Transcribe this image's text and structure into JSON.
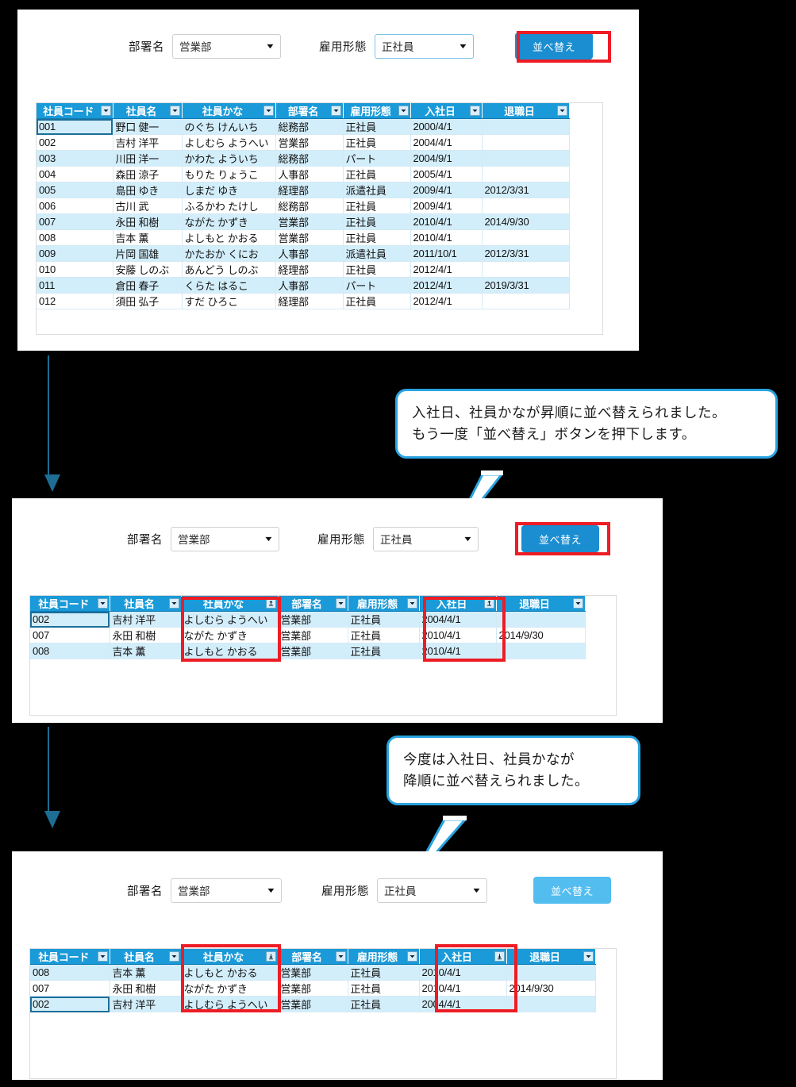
{
  "toolbar": {
    "dept_label": "部署名",
    "dept_value": "営業部",
    "emptype_label": "雇用形態",
    "emptype_value": "正社員",
    "sort_button": "並べ替え",
    "caret_icon": "▼"
  },
  "columns": [
    {
      "key": "code",
      "label": "社員コード"
    },
    {
      "key": "name",
      "label": "社員名"
    },
    {
      "key": "kana",
      "label": "社員かな"
    },
    {
      "key": "dept",
      "label": "部署名"
    },
    {
      "key": "etype",
      "label": "雇用形態"
    },
    {
      "key": "joined",
      "label": "入社日"
    },
    {
      "key": "left",
      "label": "退職日"
    }
  ],
  "panel1": {
    "sort_icons": [
      "filter",
      "filter",
      "filter",
      "filter",
      "filter",
      "filter",
      "filter"
    ],
    "rows": [
      [
        "001",
        "野口 健一",
        "のぐち けんいち",
        "総務部",
        "正社員",
        "2000/4/1",
        ""
      ],
      [
        "002",
        "吉村 洋平",
        "よしむら ようへい",
        "営業部",
        "正社員",
        "2004/4/1",
        ""
      ],
      [
        "003",
        "川田 洋一",
        "かわた よういち",
        "総務部",
        "パート",
        "2004/9/1",
        ""
      ],
      [
        "004",
        "森田 涼子",
        "もりた りょうこ",
        "人事部",
        "正社員",
        "2005/4/1",
        ""
      ],
      [
        "005",
        "島田 ゆき",
        "しまだ ゆき",
        "経理部",
        "派遣社員",
        "2009/4/1",
        "2012/3/31"
      ],
      [
        "006",
        "古川 武",
        "ふるかわ たけし",
        "総務部",
        "正社員",
        "2009/4/1",
        ""
      ],
      [
        "007",
        "永田 和樹",
        "ながた かずき",
        "営業部",
        "正社員",
        "2010/4/1",
        "2014/9/30"
      ],
      [
        "008",
        "吉本 薫",
        "よしもと かおる",
        "営業部",
        "正社員",
        "2010/4/1",
        ""
      ],
      [
        "009",
        "片岡 国雄",
        "かたおか くにお",
        "人事部",
        "派遣社員",
        "2011/10/1",
        "2012/3/31"
      ],
      [
        "010",
        "安藤 しのぶ",
        "あんどう しのぶ",
        "経理部",
        "正社員",
        "2012/4/1",
        ""
      ],
      [
        "011",
        "倉田 春子",
        "くらた はるこ",
        "人事部",
        "パート",
        "2012/4/1",
        "2019/3/31"
      ],
      [
        "012",
        "須田 弘子",
        "すだ ひろこ",
        "経理部",
        "正社員",
        "2012/4/1",
        ""
      ]
    ]
  },
  "panel2": {
    "sort_icons": [
      "filter",
      "filter",
      "asc",
      "filter",
      "filter",
      "asc",
      "filter"
    ],
    "rows": [
      [
        "002",
        "吉村 洋平",
        "よしむら ようへい",
        "営業部",
        "正社員",
        "2004/4/1",
        ""
      ],
      [
        "007",
        "永田 和樹",
        "ながた かずき",
        "営業部",
        "正社員",
        "2010/4/1",
        "2014/9/30"
      ],
      [
        "008",
        "吉本 薫",
        "よしもと かおる",
        "営業部",
        "正社員",
        "2010/4/1",
        ""
      ]
    ]
  },
  "panel3": {
    "sort_icons": [
      "filter",
      "filter",
      "desc",
      "filter",
      "filter",
      "desc",
      "filter"
    ],
    "rows": [
      [
        "008",
        "吉本 薫",
        "よしもと かおる",
        "営業部",
        "正社員",
        "2010/4/1",
        ""
      ],
      [
        "007",
        "永田 和樹",
        "ながた かずき",
        "営業部",
        "正社員",
        "2010/4/1",
        "2014/9/30"
      ],
      [
        "002",
        "吉村 洋平",
        "よしむら ようへい",
        "営業部",
        "正社員",
        "2004/4/1",
        ""
      ]
    ]
  },
  "callout1": {
    "line1": "入社日、社員かなが昇順に並べ替えられました。",
    "line2": "もう一度「並べ替え」ボタンを押下します。"
  },
  "callout2": {
    "line1": "今度は入社日、社員かなが",
    "line2": "降順に並べ替えられました。"
  },
  "colors": {
    "header_blue": "#1a9ad8",
    "button_blue": "#1a8ed1",
    "button_blue_light": "#53bdf0",
    "highlight_red": "#ee1c24",
    "arrow_teal": "#1d6d94",
    "callout_border": "#29a3e0",
    "row_band": "#d3eefb"
  }
}
